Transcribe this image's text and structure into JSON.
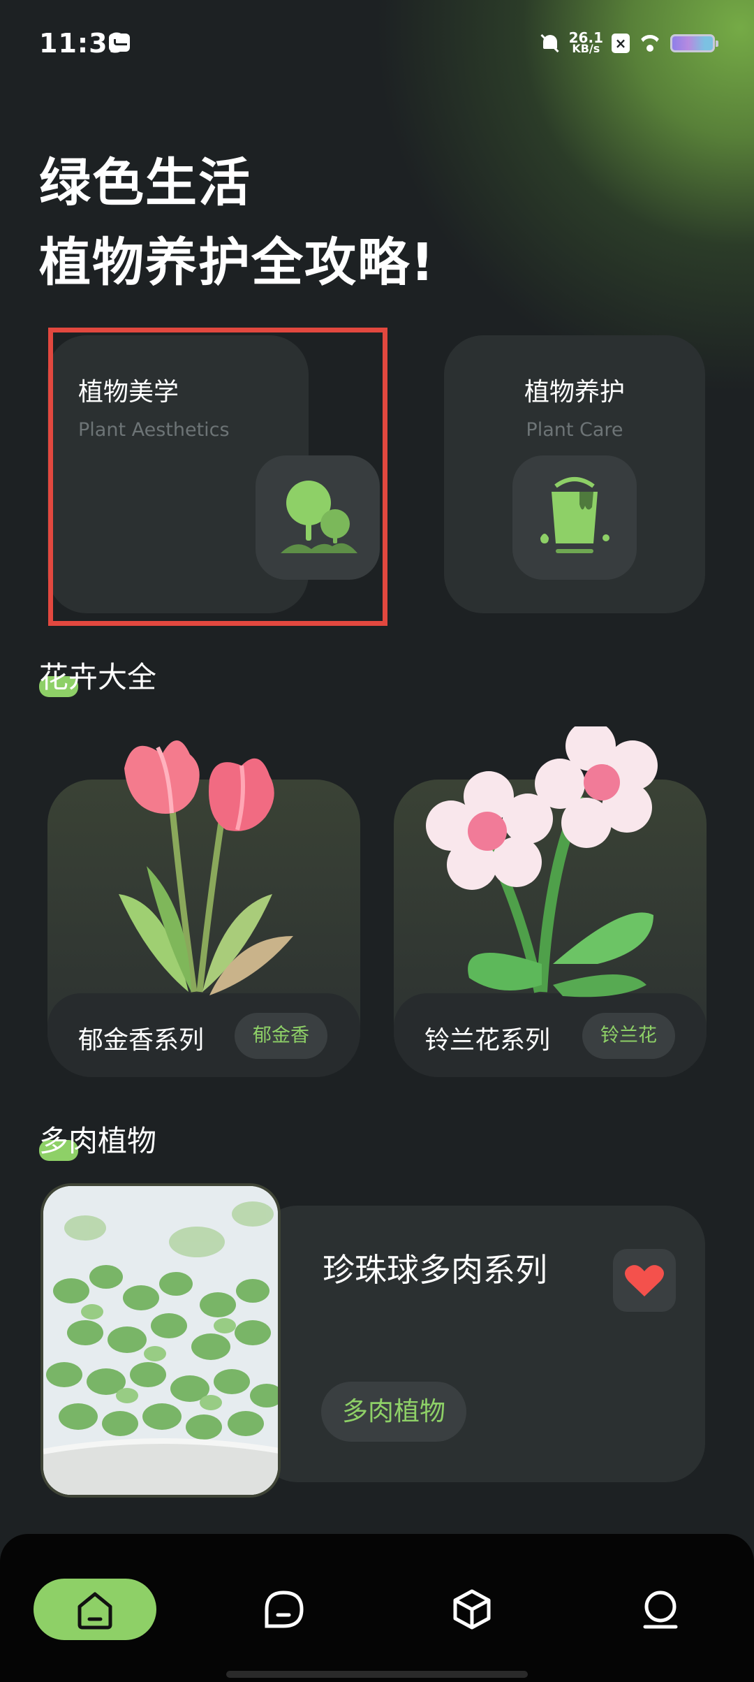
{
  "status_bar": {
    "time": "11:39",
    "net_speed_value": "26.1",
    "net_speed_unit": "KB/s",
    "x_badge": "×"
  },
  "hero": {
    "line1": "绿色生活",
    "line2": "植物养护全攻略!"
  },
  "categories": [
    {
      "title": "植物美学",
      "subtitle": "Plant Aesthetics",
      "icon": "tree-icon"
    },
    {
      "title": "植物养护",
      "subtitle": "Plant Care",
      "icon": "paint-bucket-icon"
    }
  ],
  "flowers_section": {
    "title": "花卉大全",
    "items": [
      {
        "name": "郁金香系列",
        "tag": "郁金香",
        "image": "tulip-illustration"
      },
      {
        "name": "铃兰花系列",
        "tag": "铃兰花",
        "image": "flower-illustration"
      }
    ]
  },
  "succulent_section": {
    "title": "多肉植物",
    "card": {
      "title": "珍珠球多肉系列",
      "tag": "多肉植物",
      "favorited": true
    }
  },
  "bottom_nav": [
    {
      "name": "home",
      "icon": "home-icon",
      "active": true
    },
    {
      "name": "chat",
      "icon": "chat-icon",
      "active": false
    },
    {
      "name": "box",
      "icon": "cube-icon",
      "active": false
    },
    {
      "name": "profile",
      "icon": "user-icon",
      "active": false
    }
  ],
  "colors": {
    "background": "#1d2123",
    "card": "#2b3031",
    "accent_green": "#8ed067",
    "highlight_red": "#e2483f",
    "heart_red": "#f4514c"
  }
}
